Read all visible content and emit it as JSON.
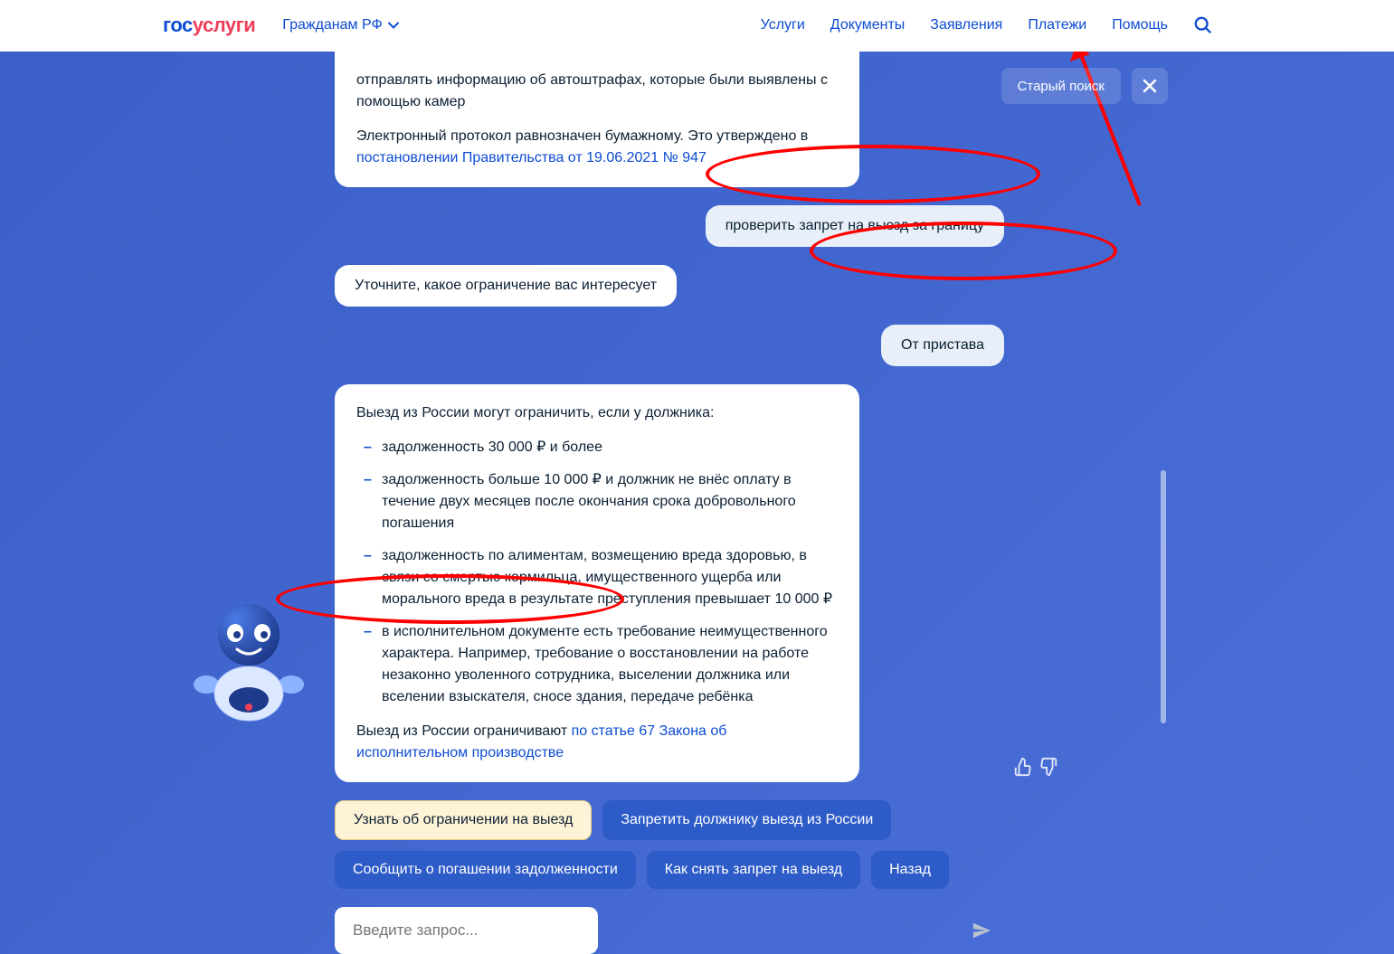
{
  "header": {
    "logo_gos": "гос",
    "logo_uslugi": "услуги",
    "citizen_label": "Гражданам РФ",
    "nav": {
      "services": "Услуги",
      "documents": "Документы",
      "applications": "Заявления",
      "payments": "Платежи",
      "help": "Помощь"
    }
  },
  "top_buttons": {
    "old_search": "Старый поиск"
  },
  "chat": {
    "msg1_p1": "отправлять информацию об автоштрафах, которые были выявлены с помощью камер",
    "msg1_p2": "Электронный протокол равнозначен бумажному. Это утверждено в ",
    "msg1_link": "постановлении Правительства от 19.06.2021 № 947",
    "user_msg1": "проверить запрет на выезд за границу",
    "bot_small": "Уточните, какое ограничение вас интересует",
    "user_msg2": "От пристава",
    "msg2_intro": "Выезд из России могут ограничить, если у должника:",
    "msg2_b1": "задолженность 30 000 ₽ и более",
    "msg2_b2": "задолженность больше 10 000 ₽ и должник не внёс оплату в течение двух месяцев после окончания срока добровольного погашения",
    "msg2_b3": "задолженность по алиментам, возмещению вреда здоровью, в связи со смертью кормильца, имущественного ущерба или морального вреда в результате преступления превышает 10 000 ₽",
    "msg2_b4": "в исполнительном документе есть требование неимущественного характера. Например, требование о восстановлении на работе незаконно уволенного сотрудника, выселении должника или вселении взыскателя, сносе здания, передаче ребёнка",
    "msg2_outro": "Выезд из России ограничивают ",
    "msg2_link": "по статье 67 Закона об исполнительном производстве"
  },
  "actions": {
    "a1": "Узнать об ограничении на выезд",
    "a2": "Запретить должнику выезд из России",
    "a3": "Сообщить о погашении задолженности",
    "a4": "Как снять запрет на выезд",
    "a5": "Назад"
  },
  "input": {
    "placeholder": "Введите запрос..."
  }
}
